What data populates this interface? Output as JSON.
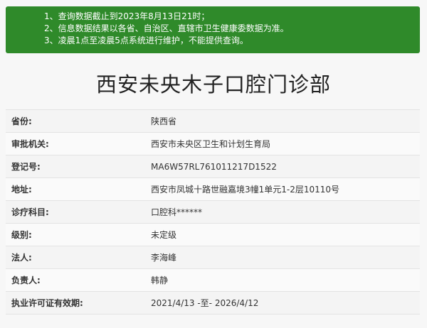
{
  "notice": {
    "items": [
      "1、查询数据截止到2023年8月13日21时；",
      "2、信息数据结果以各省、自治区、直辖市卫生健康委数据为准。",
      "3、凌晨1点至凌晨5点系统进行维护，不能提供查询。"
    ],
    "background_color": "#2f8a2a"
  },
  "page_title": "西安未央木子口腔门诊部",
  "info_table": {
    "rows": [
      {
        "label": "省份:",
        "value": "陕西省"
      },
      {
        "label": "审批机关:",
        "value": "西安市未央区卫生和计划生育局"
      },
      {
        "label": "登记号:",
        "value": "MA6W57RL761011217D1522"
      },
      {
        "label": "地址:",
        "value": "西安市凤城十路世融嘉境3幢1单元1-2层10110号"
      },
      {
        "label": "诊疗科目:",
        "value": "口腔科******"
      },
      {
        "label": "级别:",
        "value": "未定级"
      },
      {
        "label": "法人:",
        "value": "李海峰"
      },
      {
        "label": "负责人:",
        "value": "韩静"
      },
      {
        "label": "执业许可证有效期:",
        "value": "2021/4/13 -至- 2026/4/12"
      }
    ]
  }
}
